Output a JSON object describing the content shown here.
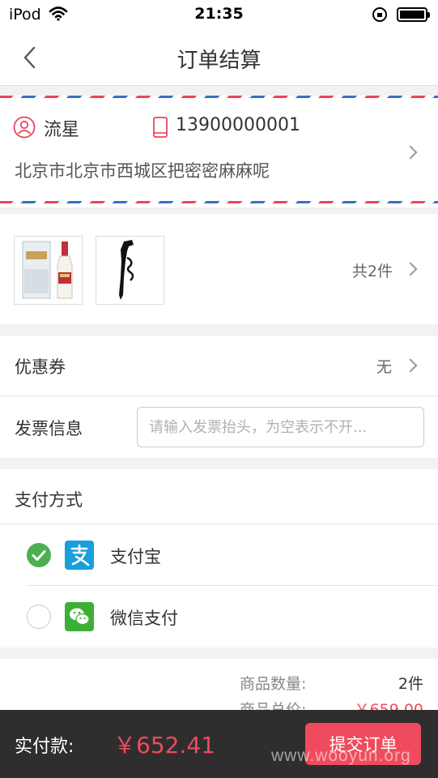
{
  "status_bar": {
    "carrier": "iPod",
    "time": "21:35",
    "icons": [
      "wifi-icon",
      "orientation-lock-icon",
      "battery-icon"
    ]
  },
  "nav": {
    "title": "订单结算",
    "back_icon": "chevron-left-icon"
  },
  "address": {
    "name": "流星",
    "phone": "13900000001",
    "detail": "北京市北京市西城区把密密麻麻呢",
    "colors": {
      "accent": "#e8465a",
      "airmail_blue": "#3a6fc4"
    }
  },
  "goods": {
    "items": [
      "wine-bottle-thumbnail",
      "corkscrew-thumbnail"
    ],
    "count_label": "共2件"
  },
  "coupon": {
    "label": "优惠券",
    "value": "无"
  },
  "invoice": {
    "label": "发票信息",
    "placeholder": "请输入发票抬头，为空表示不开...",
    "value": ""
  },
  "payment": {
    "title": "支付方式",
    "options": [
      {
        "label": "支付宝",
        "selected": true,
        "icon": "alipay-icon",
        "color": "#1a9fdb"
      },
      {
        "label": "微信支付",
        "selected": false,
        "icon": "wechat-icon",
        "color": "#3cb034"
      }
    ]
  },
  "summary": {
    "rows": [
      {
        "label": "商品数量:",
        "value": "2件"
      },
      {
        "label": "商品总价:",
        "value": "￥659.00"
      }
    ]
  },
  "footer": {
    "pay_label": "实付款:",
    "amount": "￥652.41",
    "submit_label": "提交订单",
    "watermark": "www.wooyun.org",
    "colors": {
      "bar": "#2e2e2e",
      "price": "#f04b5c"
    }
  }
}
